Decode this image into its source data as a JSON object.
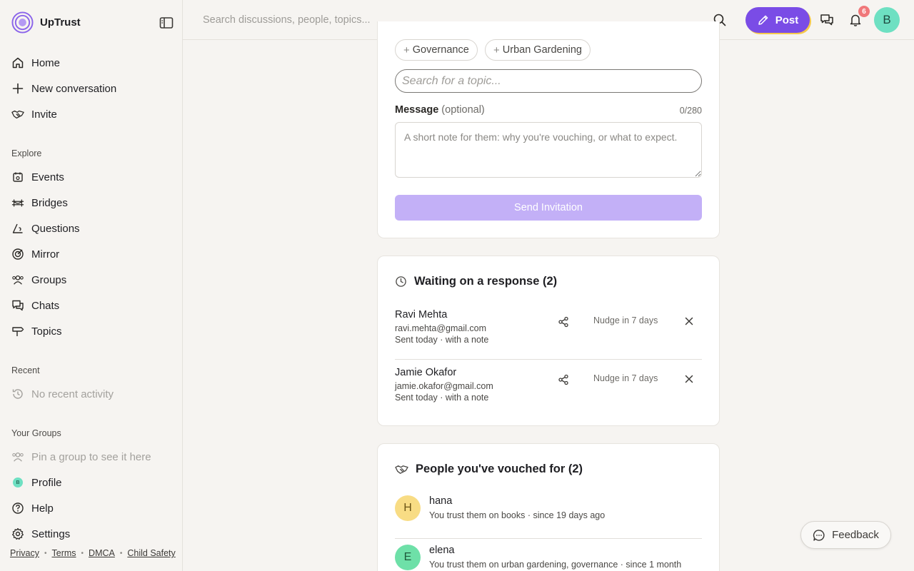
{
  "brand": {
    "name": "UpTrust"
  },
  "nav": {
    "home": "Home",
    "new_conversation": "New conversation",
    "invite": "Invite",
    "explore_label": "Explore",
    "events": "Events",
    "bridges": "Bridges",
    "questions": "Questions",
    "mirror": "Mirror",
    "groups": "Groups",
    "chats": "Chats",
    "topics": "Topics",
    "recent_label": "Recent",
    "recent_empty": "No recent activity",
    "your_groups_label": "Your Groups",
    "groups_empty": "Pin a group to see it here",
    "profile": "Profile",
    "profile_initial": "B",
    "help": "Help",
    "settings": "Settings"
  },
  "footer": {
    "privacy": "Privacy",
    "terms": "Terms",
    "dmca": "DMCA",
    "child_safety": "Child Safety"
  },
  "header": {
    "search_placeholder": "Search discussions, people, topics...",
    "post_label": "Post",
    "notification_count": "6",
    "avatar_initial": "B"
  },
  "invite_form": {
    "chips": [
      "Governance",
      "Urban Gardening"
    ],
    "topic_search_placeholder": "Search for a topic...",
    "message_label": "Message",
    "message_optional": "(optional)",
    "message_count": "0/280",
    "message_placeholder": "A short note for them: why you're vouching, or what to expect.",
    "send_label": "Send Invitation"
  },
  "pending": {
    "title": "Waiting on a response (2)",
    "items": [
      {
        "name": "Ravi Mehta",
        "email": "ravi.mehta@gmail.com",
        "meta": "Sent today · with a note",
        "nudge": "Nudge in 7 days"
      },
      {
        "name": "Jamie Okafor",
        "email": "jamie.okafor@gmail.com",
        "meta": "Sent today · with a note",
        "nudge": "Nudge in 7 days"
      }
    ]
  },
  "vouched": {
    "title": "People you've vouched for (2)",
    "items": [
      {
        "initial": "H",
        "name": "hana",
        "meta": "You trust them on books · since 19 days ago",
        "color": "#f8dc84"
      },
      {
        "initial": "E",
        "name": "elena",
        "meta": "You trust them on urban gardening, governance · since 1 month",
        "color": "#6ee0a8"
      }
    ]
  },
  "feedback": {
    "label": "Feedback"
  },
  "colors": {
    "accent": "#7a4ce6",
    "send_disabled": "#c3b0f7",
    "badge": "#f0787a",
    "avatar": "#6ee0c2"
  }
}
